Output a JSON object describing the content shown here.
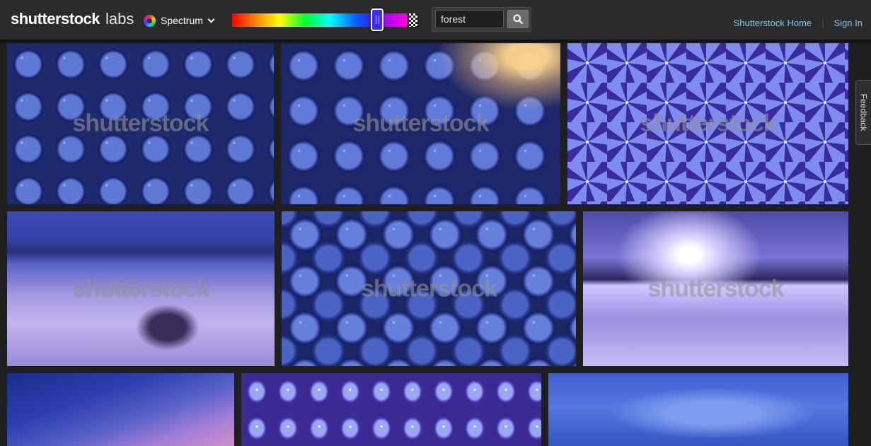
{
  "header": {
    "logo_brand": "shutterstock",
    "logo_labs": "labs",
    "mode": {
      "label": "Spectrum",
      "icon": "spectrum-color-wheel-icon"
    },
    "spectrum": {
      "selected_position": 0.83,
      "selected_color": "#3b2cff"
    },
    "search": {
      "value": "forest",
      "button_icon": "search-icon"
    },
    "nav": {
      "home_label": "Shutterstock Home",
      "separator": "|",
      "signin_label": "Sign In"
    }
  },
  "results": {
    "watermark": "shutterstock",
    "images": [
      {
        "subject": "blueberries"
      },
      {
        "subject": "blueberries-sunlight"
      },
      {
        "subject": "blue-hyacinth-flowers"
      },
      {
        "subject": "foggy-field"
      },
      {
        "subject": "blueberries"
      },
      {
        "subject": "winter-lake-sunset"
      },
      {
        "subject": "twilight-sky"
      },
      {
        "subject": "blue-hyacinth-flowers"
      },
      {
        "subject": "cloudy-sky"
      }
    ]
  },
  "feedback": {
    "label": "Feedback"
  },
  "colors": {
    "header_bg": "#2b2b2b",
    "page_bg": "#1f1f1f",
    "link": "#8fc7e8",
    "accent": "#3b2cff"
  }
}
